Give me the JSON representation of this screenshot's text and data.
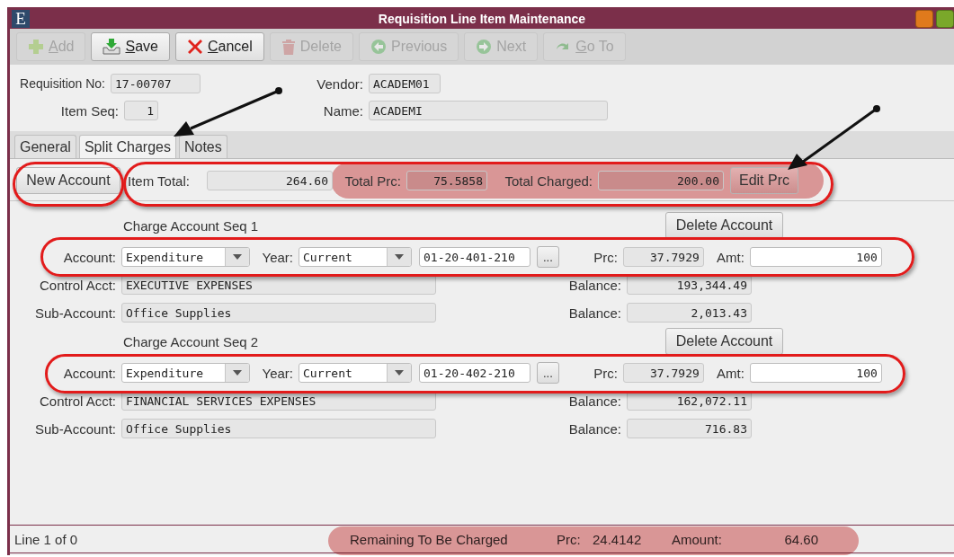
{
  "window": {
    "logo": "E",
    "title": "Requisition Line Item Maintenance"
  },
  "toolbar": [
    {
      "kind": "add",
      "label": "Add",
      "disabled": true,
      "mnemonic": true
    },
    {
      "kind": "save",
      "label": "Save",
      "disabled": false,
      "mnemonic": true
    },
    {
      "kind": "cancel",
      "label": "Cancel",
      "disabled": false,
      "mnemonic": true
    },
    {
      "kind": "delete",
      "label": "Delete",
      "disabled": true,
      "mnemonic": false
    },
    {
      "kind": "previous",
      "label": "Previous",
      "disabled": true,
      "mnemonic": false
    },
    {
      "kind": "next",
      "label": "Next",
      "disabled": true,
      "mnemonic": false
    },
    {
      "kind": "goto",
      "label": "Go To",
      "disabled": true,
      "mnemonic": true
    }
  ],
  "header": {
    "requisition_no": {
      "label": "Requisition No:",
      "value": "17-00707"
    },
    "item_seq": {
      "label": "Item Seq:",
      "value": "1"
    },
    "vendor": {
      "label": "Vendor:",
      "value": "ACADEM01"
    },
    "name": {
      "label": "Name:",
      "value": "ACADEMI"
    }
  },
  "tabs": [
    {
      "label": "General",
      "selected": false
    },
    {
      "label": "Split Charges",
      "selected": true
    },
    {
      "label": "Notes",
      "selected": false
    }
  ],
  "summary": {
    "new_account": "New Account",
    "item_total": {
      "label": "Item Total:",
      "value": "264.60"
    },
    "total_prc": {
      "label": "Total Prc:",
      "value": "75.5858"
    },
    "total_charged": {
      "label": "Total Charged:",
      "value": "200.00"
    },
    "edit_prc": "Edit Prc"
  },
  "accounts": [
    {
      "heading": "Charge Account Seq 1",
      "delete": "Delete Account",
      "account": {
        "label": "Account:",
        "value": "Expenditure"
      },
      "year": {
        "label": "Year:",
        "value": "Current"
      },
      "code": "01-20-401-210",
      "browse": "...",
      "prc": {
        "label": "Prc:",
        "value": "37.7929"
      },
      "amt": {
        "label": "Amt:",
        "value": "100"
      },
      "control": {
        "label": "Control Acct:",
        "value": "EXECUTIVE EXPENSES"
      },
      "control_balance": {
        "label": "Balance:",
        "value": "193,344.49"
      },
      "sub": {
        "label": "Sub-Account:",
        "value": "Office Supplies"
      },
      "sub_balance": {
        "label": "Balance:",
        "value": "2,013.43"
      }
    },
    {
      "heading": "Charge Account Seq 2",
      "delete": "Delete Account",
      "account": {
        "label": "Account:",
        "value": "Expenditure"
      },
      "year": {
        "label": "Year:",
        "value": "Current"
      },
      "code": "01-20-402-210",
      "browse": "...",
      "prc": {
        "label": "Prc:",
        "value": "37.7929"
      },
      "amt": {
        "label": "Amt:",
        "value": "100"
      },
      "control": {
        "label": "Control Acct:",
        "value": "FINANCIAL SERVICES EXPENSES"
      },
      "control_balance": {
        "label": "Balance:",
        "value": "162,072.11"
      },
      "sub": {
        "label": "Sub-Account:",
        "value": "Office Supplies"
      },
      "sub_balance": {
        "label": "Balance:",
        "value": "716.83"
      }
    }
  ],
  "status_bar": {
    "line": "Line 1 of 0",
    "remaining": "Remaining To Be Charged",
    "prc_label": "Prc:",
    "prc": "24.4142",
    "amount_label": "Amount:",
    "amount": "64.60"
  }
}
